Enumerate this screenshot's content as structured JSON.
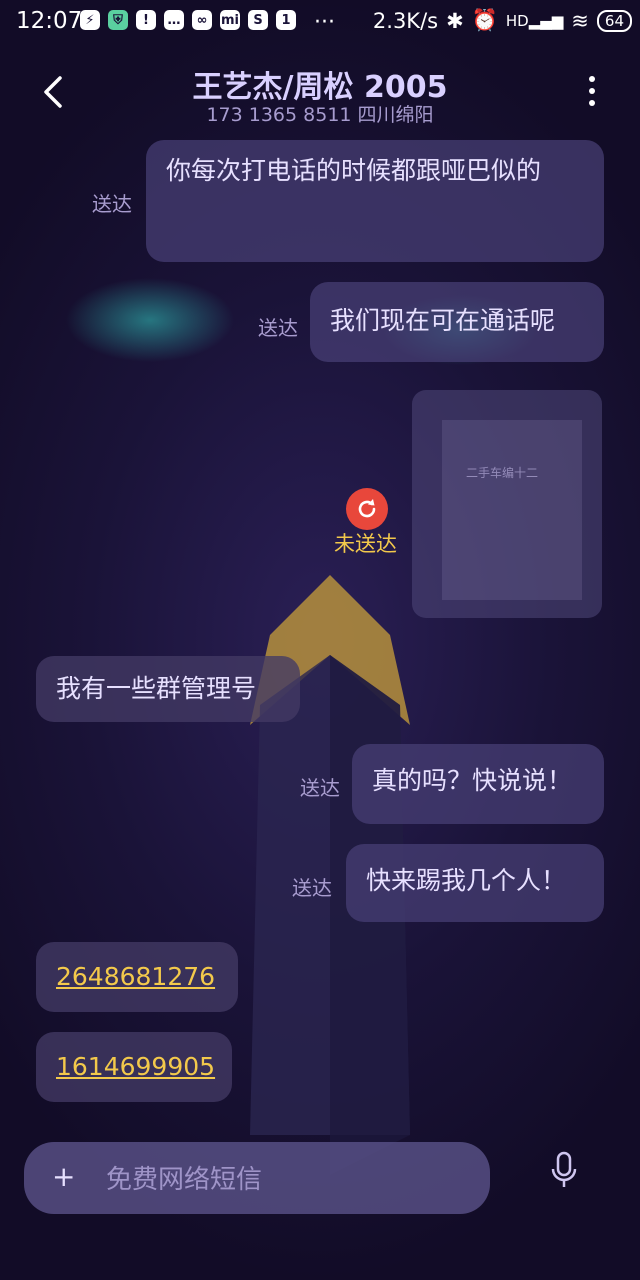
{
  "status_bar": {
    "time": "12:07",
    "net_speed": "2.3K/s",
    "battery": "64",
    "icons": [
      "bolt-icon",
      "shield-icon",
      "alert-icon",
      "chat-icon",
      "vr-icon",
      "mi-icon",
      "skype-icon",
      "sim-icon",
      "more-icon",
      "bluetooth-icon",
      "alarm-icon",
      "hd-signal-icon",
      "wifi-icon",
      "battery-icon"
    ]
  },
  "header": {
    "title": "王艺杰/周松 2005",
    "subtitle": "173 1365 8511 四川绵阳"
  },
  "messages": [
    {
      "id": 1,
      "direction": "sent",
      "text": "你每次打电话的时候都跟哑巴似的",
      "status": "送达"
    },
    {
      "id": 2,
      "direction": "sent",
      "text": "我们现在可在通话呢",
      "status": "送达"
    },
    {
      "id": 3,
      "direction": "sent",
      "type": "image",
      "image_text": "二手车编十二",
      "status": "未送达"
    },
    {
      "id": 4,
      "direction": "received",
      "text": "我有一些群管理号"
    },
    {
      "id": 5,
      "direction": "sent",
      "text": "真的吗？快说说！",
      "status": "送达"
    },
    {
      "id": 6,
      "direction": "sent",
      "text": "快来踢我几个人！",
      "status": "送达"
    },
    {
      "id": 7,
      "direction": "received",
      "link": "2648681276"
    },
    {
      "id": 8,
      "direction": "received",
      "link": "1614699905"
    }
  ],
  "input": {
    "plus_label": "+",
    "placeholder": "免费网络短信"
  },
  "colors": {
    "background": "#140e2a",
    "bubble": "#48407a",
    "accent_link": "#f3c94b",
    "error": "#e8473b",
    "glow": "#32c8be"
  }
}
